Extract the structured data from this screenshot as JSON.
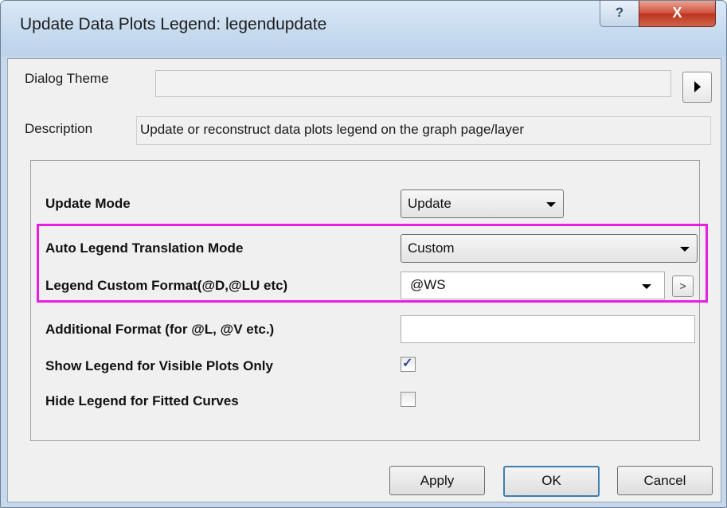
{
  "window": {
    "title": "Update Data Plots Legend: legendupdate",
    "help_label": "?",
    "close_label": "X"
  },
  "dialog_theme": {
    "label": "Dialog Theme",
    "value": ""
  },
  "description": {
    "label": "Description",
    "text": "Update or reconstruct data plots legend on the graph page/layer"
  },
  "fields": {
    "update_mode": {
      "label": "Update Mode",
      "value": "Update"
    },
    "auto_translation": {
      "label": "Auto Legend Translation Mode",
      "value": "Custom"
    },
    "custom_format": {
      "label": "Legend Custom Format(@D,@LU etc)",
      "value": "@WS",
      "button": ">"
    },
    "additional_format": {
      "label": "Additional Format (for @L, @V etc.)",
      "value": ""
    },
    "visible_only": {
      "label": "Show Legend for Visible Plots Only",
      "checked": true
    },
    "hide_fitted": {
      "label": "Hide Legend for Fitted Curves",
      "checked": false
    }
  },
  "buttons": {
    "apply": "Apply",
    "ok": "OK",
    "cancel": "Cancel"
  },
  "colors": {
    "highlight": "#ea1ee0",
    "close_button": "#c7422d",
    "titlebar": "#c5d8ec"
  },
  "icons": {
    "theme_arrow": "triangle-right-icon",
    "dropdown": "chevron-down-icon",
    "check": "checkmark-icon"
  }
}
